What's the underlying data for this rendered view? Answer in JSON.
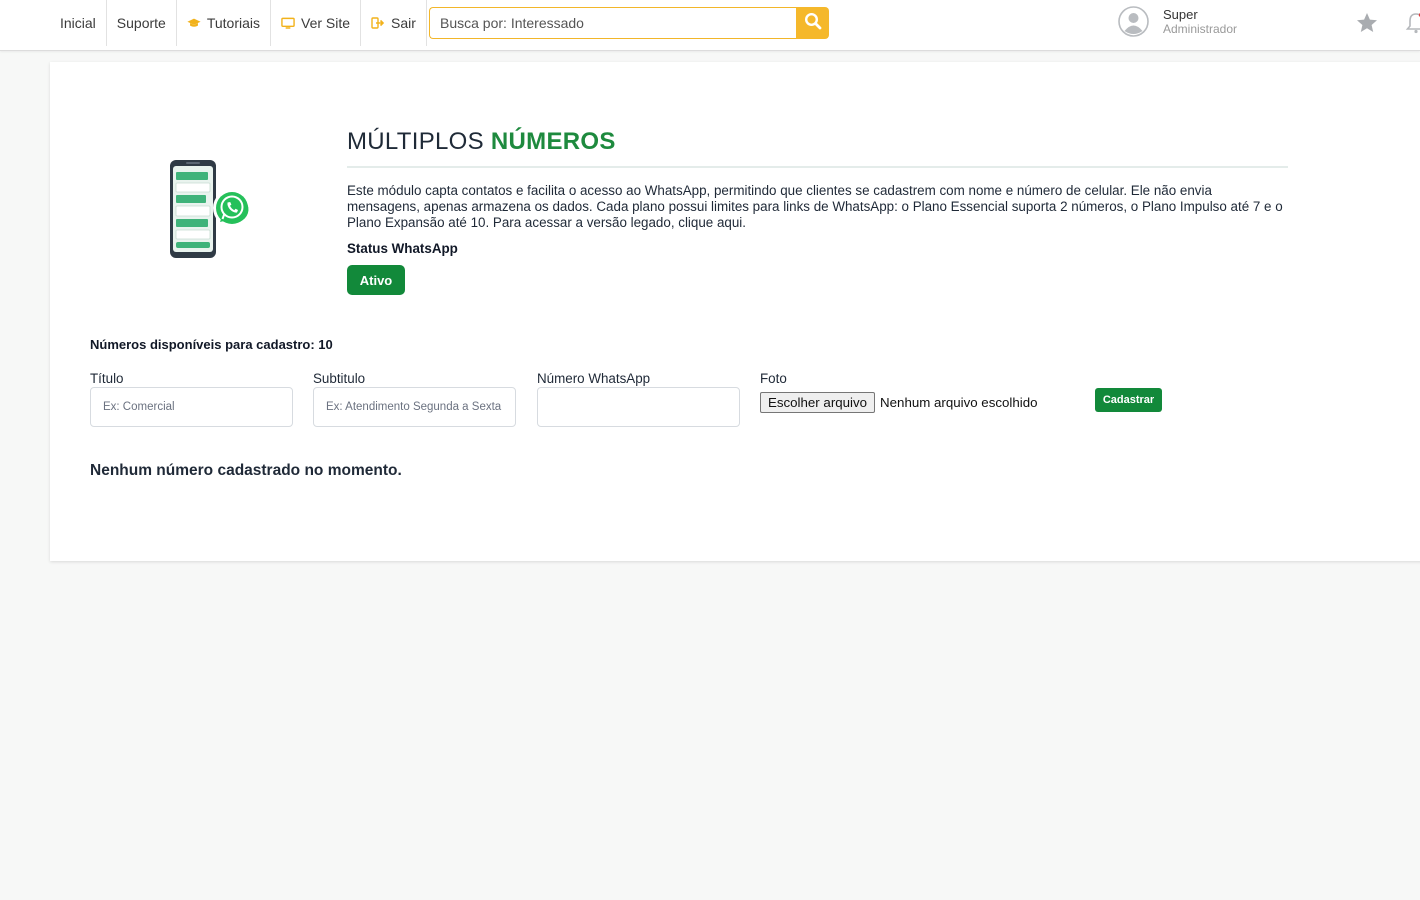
{
  "nav": {
    "items": [
      {
        "label": "Inicial",
        "icon": ""
      },
      {
        "label": "Suporte",
        "icon": ""
      },
      {
        "label": "Tutoriais",
        "icon": "graduation-cap-icon"
      },
      {
        "label": "Ver Site",
        "icon": "monitor-icon"
      },
      {
        "label": "Sair",
        "icon": "sign-out-icon"
      }
    ]
  },
  "search": {
    "placeholder": "Busca por: Interessado",
    "value": ""
  },
  "user": {
    "name": "Super",
    "role": "Administrador"
  },
  "page": {
    "title_light": "MÚLTIPLOS",
    "title_bold": "NÚMEROS",
    "description": "Este módulo capta contatos e facilita o acesso ao WhatsApp, permitindo que clientes se cadastrem com nome e número de celular. Ele não envia mensagens, apenas armazena os dados. Cada plano possui limites para links de WhatsApp: o Plano Essencial suporta 2 números, o Plano Impulso até 7 e o Plano Expansão até 10. Para acessar a versão legado, clique aqui.",
    "status_label": "Status WhatsApp",
    "status_button": "Ativo",
    "available_label": "Números disponíveis para cadastro: 10"
  },
  "form": {
    "title_label": "Título",
    "title_placeholder": "Ex: Comercial",
    "subtitle_label": "Subtitulo",
    "subtitle_placeholder": "Ex: Atendimento Segunda a Sexta",
    "number_label": "Número WhatsApp",
    "number_placeholder": "",
    "photo_label": "Foto",
    "file_button": "Escolher arquivo",
    "file_status": "Nenhum arquivo escolhido",
    "submit": "Cadastrar"
  },
  "empty_message": "Nenhum número cadastrado no momento.",
  "colors": {
    "accent_green": "#12893a",
    "title_green": "#1e8a3e",
    "search_yellow": "#f5b82b",
    "background": "#f7f8f7"
  }
}
